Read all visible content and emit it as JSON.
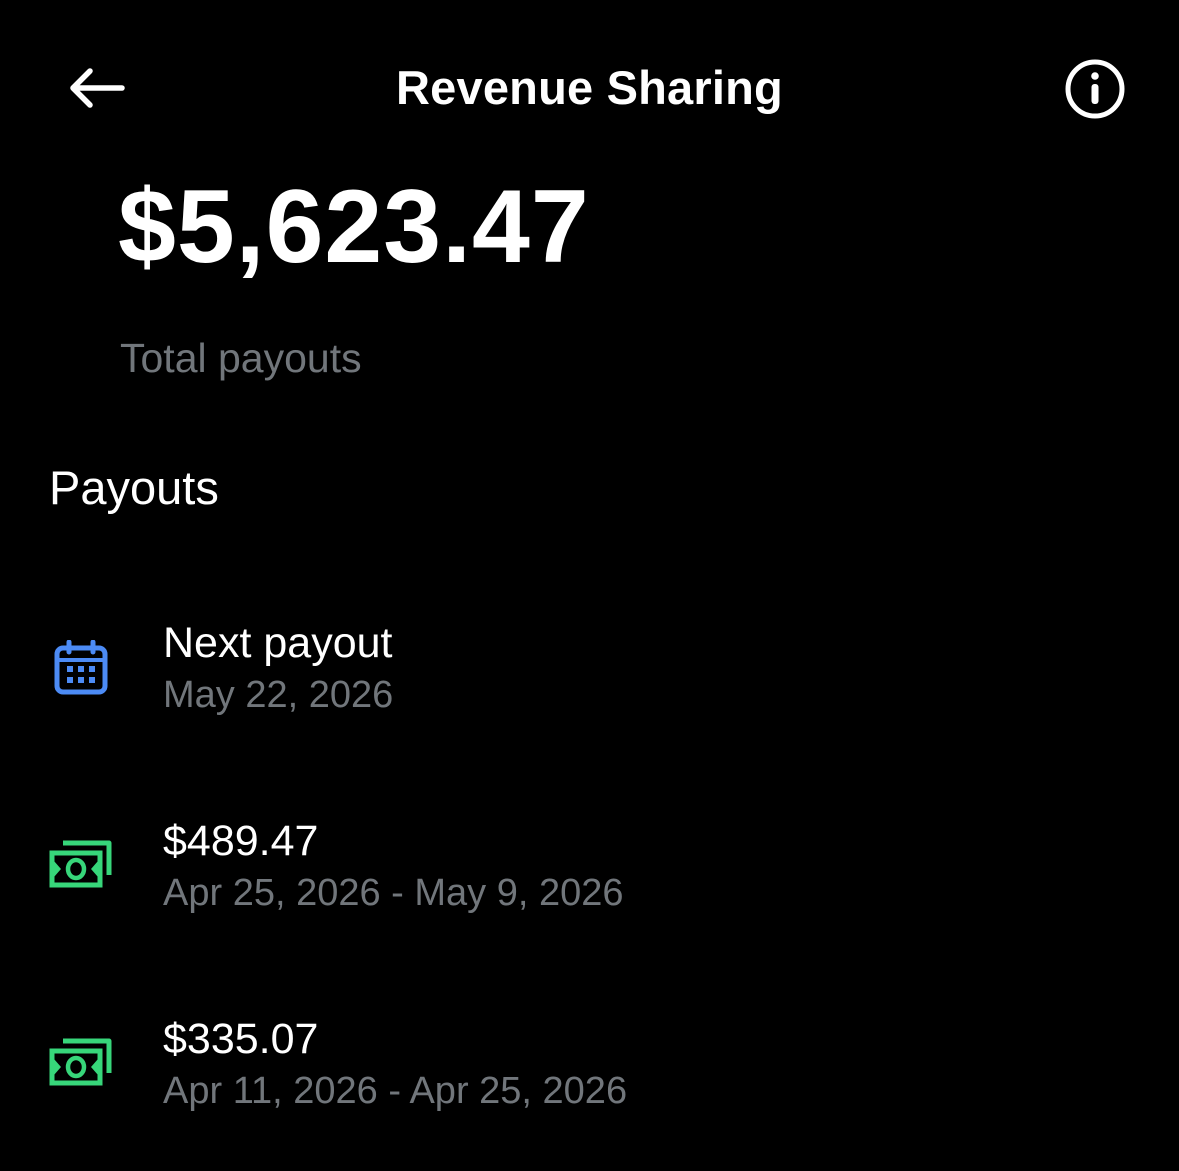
{
  "header": {
    "title": "Revenue Sharing",
    "back_icon": "arrow-left-icon",
    "info_icon": "info-circle-icon"
  },
  "summary": {
    "total_amount": "$5,623.47",
    "total_label": "Total payouts"
  },
  "payouts": {
    "section_title": "Payouts",
    "next": {
      "icon": "calendar-icon",
      "label": "Next payout",
      "date": "May 22, 2026"
    },
    "items": [
      {
        "icon": "money-icon",
        "amount": "$489.47",
        "period": "Apr 25, 2026 - May 9, 2026"
      },
      {
        "icon": "money-icon",
        "amount": "$335.07",
        "period": "Apr 11, 2026 - Apr 25, 2026"
      }
    ]
  },
  "colors": {
    "background": "#000000",
    "text": "#ffffff",
    "muted": "#71767b",
    "calendar_accent": "#4c8bf5",
    "money_accent": "#37d67a"
  }
}
